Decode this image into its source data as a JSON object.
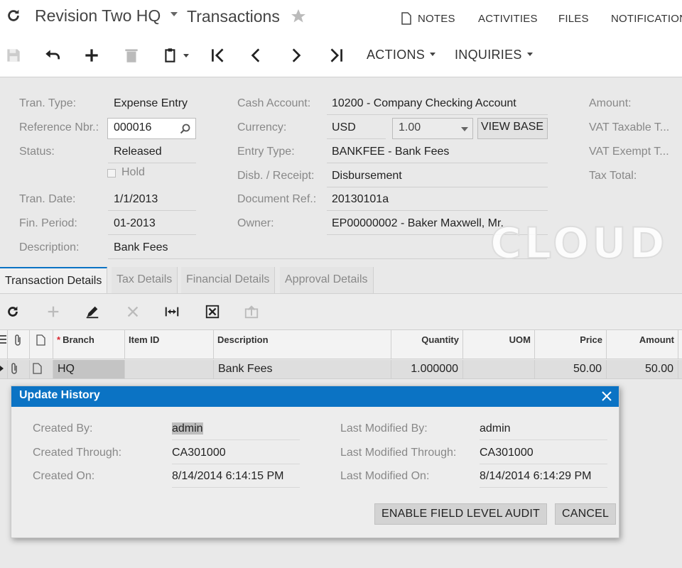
{
  "header": {
    "company": "Revision Two HQ",
    "screen_title": "Transactions",
    "links": [
      "NOTES",
      "ACTIVITIES",
      "FILES",
      "NOTIFICATION"
    ]
  },
  "toolbar": {
    "actions_label": "ACTIONS",
    "inquiries_label": "INQUIRIES"
  },
  "form": {
    "tran_type_label": "Tran. Type:",
    "tran_type": "Expense Entry",
    "reference_label": "Reference Nbr.:",
    "reference": "000016",
    "status_label": "Status:",
    "status": "Released",
    "hold_label": "Hold",
    "tran_date_label": "Tran. Date:",
    "tran_date": "1/1/2013",
    "fin_period_label": "Fin. Period:",
    "fin_period": "01-2013",
    "description_label": "Description:",
    "description": "Bank Fees",
    "cash_account_label": "Cash Account:",
    "cash_account": "10200 - Company Checking Account",
    "currency_label": "Currency:",
    "currency": "USD",
    "rate": "1.00",
    "view_base_label": "VIEW BASE",
    "entry_type_label": "Entry Type:",
    "entry_type": "BANKFEE - Bank Fees",
    "disb_label": "Disb. / Receipt:",
    "disb": "Disbursement",
    "doc_ref_label": "Document Ref.:",
    "doc_ref": "20130101a",
    "owner_label": "Owner:",
    "owner": "EP00000002 - Baker Maxwell, Mr.",
    "amount_label": "Amount:",
    "vat_taxable_label": "VAT Taxable T...",
    "vat_exempt_label": "VAT Exempt T...",
    "tax_total_label": "Tax Total:",
    "watermark": "CLOUD"
  },
  "tabs": [
    "Transaction Details",
    "Tax Details",
    "Financial Details",
    "Approval Details"
  ],
  "grid": {
    "columns": [
      "Branch",
      "Item ID",
      "Description",
      "Quantity",
      "UOM",
      "Price",
      "Amount"
    ],
    "rows": [
      {
        "branch": "HQ",
        "item_id": "",
        "description": "Bank Fees",
        "quantity": "1.000000",
        "uom": "",
        "price": "50.00",
        "amount": "50.00"
      }
    ]
  },
  "dialog": {
    "title": "Update History",
    "created_by_label": "Created By:",
    "created_by": "admin",
    "created_through_label": "Created Through:",
    "created_through": "CA301000",
    "created_on_label": "Created On:",
    "created_on": "8/14/2014 6:14:15 PM",
    "modified_by_label": "Last Modified By:",
    "modified_by": "admin",
    "modified_through_label": "Last Modified Through:",
    "modified_through": "CA301000",
    "modified_on_label": "Last Modified On:",
    "modified_on": "8/14/2014 6:14:29 PM",
    "audit_button": "ENABLE FIELD LEVEL AUDIT",
    "cancel_button": "CANCEL"
  },
  "colors": {
    "accent": "#0b73c4",
    "required": "#d9262f"
  }
}
